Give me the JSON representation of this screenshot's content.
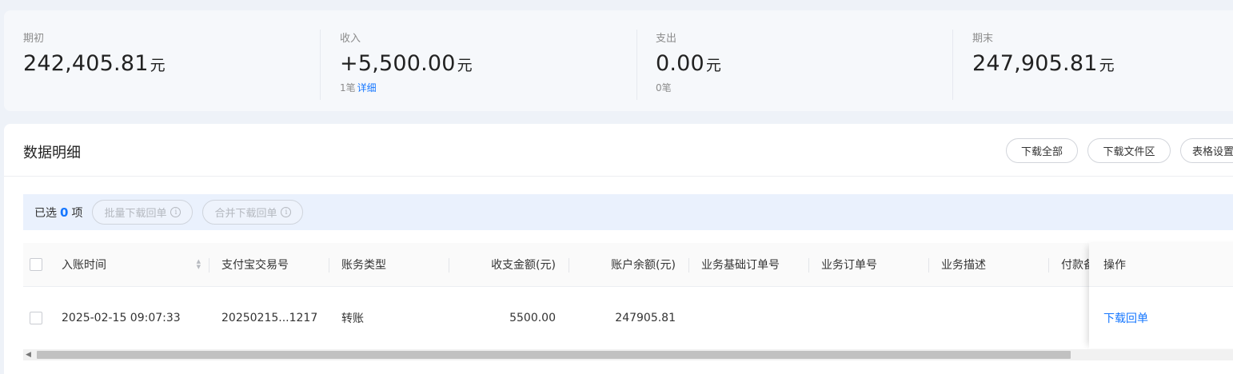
{
  "summary": {
    "opening": {
      "label": "期初",
      "amount": "242,405.81",
      "unit": "元"
    },
    "income": {
      "label": "收入",
      "amount": "+5,500.00",
      "unit": "元",
      "count": "1笔",
      "detail_link": "详细"
    },
    "expense": {
      "label": "支出",
      "amount": "0.00",
      "unit": "元",
      "count": "0笔"
    },
    "closing": {
      "label": "期末",
      "amount": "247,905.81",
      "unit": "元"
    }
  },
  "panel": {
    "title": "数据明细",
    "buttons": {
      "download_all": "下载全部",
      "download_area": "下载文件区",
      "table_settings": "表格设置"
    }
  },
  "selection": {
    "prefix": "已选",
    "count": "0",
    "suffix": "项",
    "batch_download": "批量下载回单",
    "merge_download": "合并下载回单",
    "info_icon": "i"
  },
  "table": {
    "columns": {
      "time": "入账时间",
      "trade_no": "支付宝交易号",
      "type": "账务类型",
      "amount": "收支金额(元)",
      "balance": "账户余额(元)",
      "base_order": "业务基础订单号",
      "order": "业务订单号",
      "desc": "业务描述",
      "payer_note": "付款备",
      "action": "操作"
    },
    "rows": [
      {
        "time": "2025-02-15 09:07:33",
        "trade_no": "20250215...1217",
        "type": "转账",
        "amount": "5500.00",
        "balance": "247905.81",
        "base_order": "",
        "order": "",
        "desc": "",
        "payer_note": "",
        "action": "下载回单"
      }
    ]
  },
  "colors": {
    "accent": "#1677ff",
    "selection_bg": "#eaf1fd",
    "page_bg": "#eef2f8"
  },
  "icons": {
    "sort": "sort-icon",
    "info": "info-circle-icon",
    "scroll_left": "scroll-left-arrow-icon"
  }
}
